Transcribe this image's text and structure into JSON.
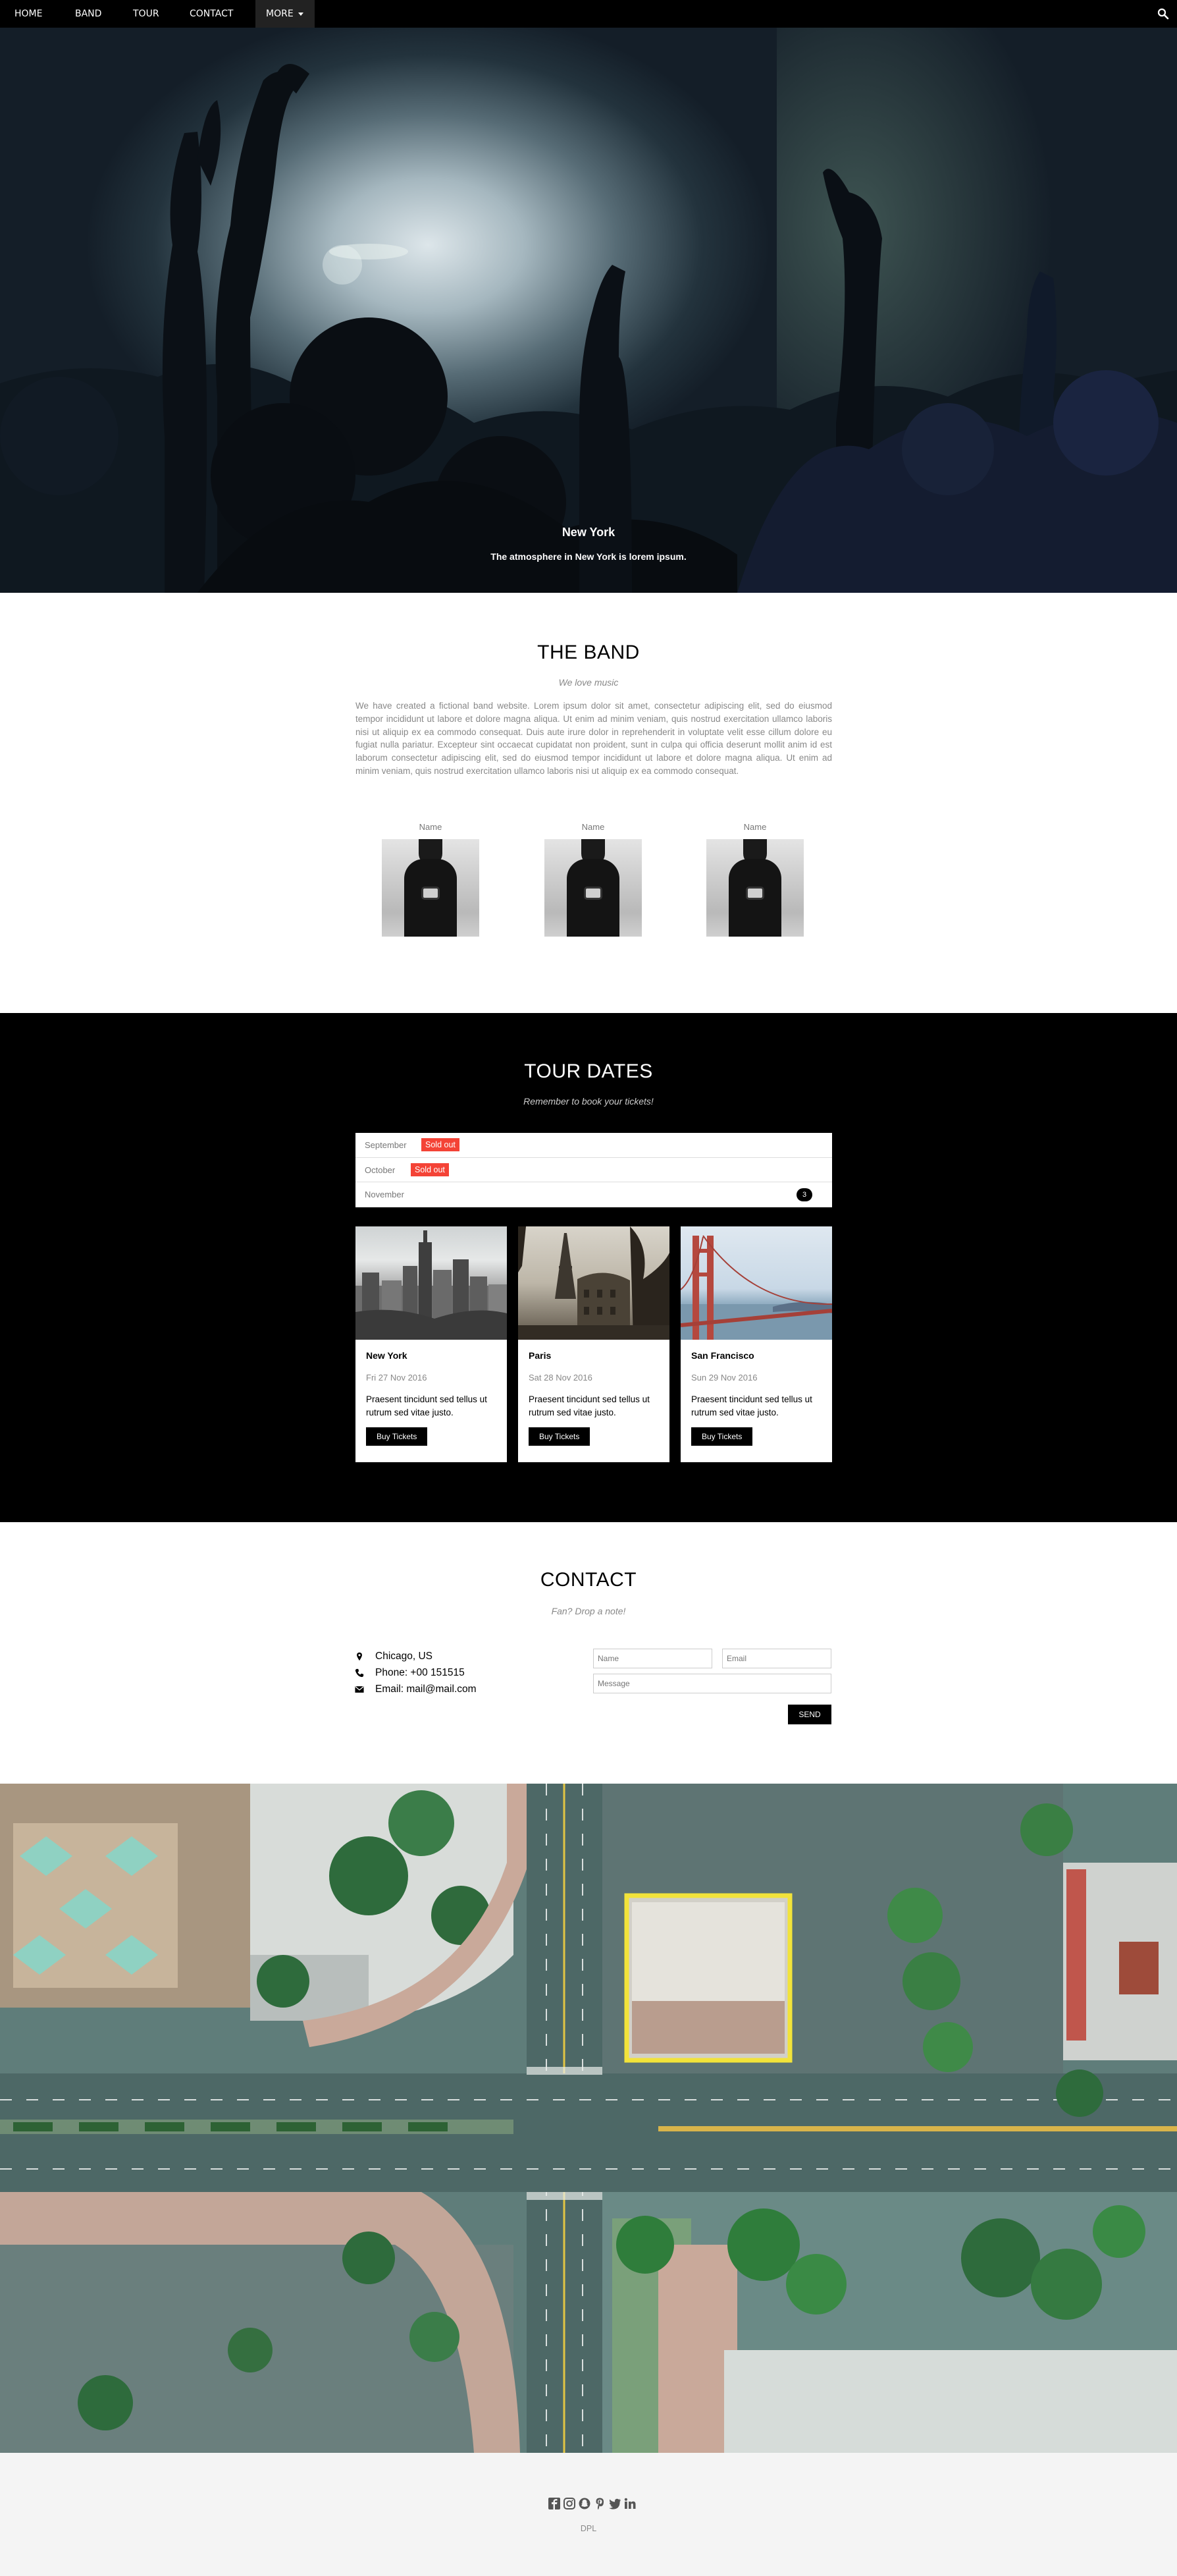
{
  "nav": {
    "items": [
      "HOME",
      "BAND",
      "TOUR",
      "CONTACT"
    ],
    "more_label": "MORE"
  },
  "hero": {
    "title": "New York",
    "subtitle": "The atmosphere in New York is lorem ipsum."
  },
  "band": {
    "title": "THE BAND",
    "subtitle": "We love music",
    "paragraph": "We have created a fictional band website. Lorem ipsum dolor sit amet, consectetur adipiscing elit, sed do eiusmod tempor incididunt ut labore et dolore magna aliqua. Ut enim ad minim veniam, quis nostrud exercitation ullamco laboris nisi ut aliquip ex ea commodo consequat. Duis aute irure dolor in reprehenderit in voluptate velit esse cillum dolore eu fugiat nulla pariatur. Excepteur sint occaecat cupidatat non proident, sunt in culpa qui officia deserunt mollit anim id est laborum consectetur adipiscing elit, sed do eiusmod tempor incididunt ut labore et dolore magna aliqua. Ut enim ad minim veniam, quis nostrud exercitation ullamco laboris nisi ut aliquip ex ea commodo consequat.",
    "members": [
      {
        "name": "Name"
      },
      {
        "name": "Name"
      },
      {
        "name": "Name"
      }
    ]
  },
  "tour": {
    "title": "TOUR DATES",
    "subtitle": "Remember to book your tickets!",
    "months": [
      {
        "month": "September",
        "status": "Sold out"
      },
      {
        "month": "October",
        "status": "Sold out"
      },
      {
        "month": "November",
        "badge": "3"
      }
    ],
    "cards": [
      {
        "city": "New York",
        "date": "Fri 27 Nov 2016",
        "desc": "Praesent tincidunt sed tellus ut rutrum sed vitae justo.",
        "button": "Buy Tickets"
      },
      {
        "city": "Paris",
        "date": "Sat 28 Nov 2016",
        "desc": "Praesent tincidunt sed tellus ut rutrum sed vitae justo.",
        "button": "Buy Tickets"
      },
      {
        "city": "San Francisco",
        "date": "Sun 29 Nov 2016",
        "desc": "Praesent tincidunt sed tellus ut rutrum sed vitae justo.",
        "button": "Buy Tickets"
      }
    ]
  },
  "contact": {
    "title": "CONTACT",
    "subtitle": "Fan? Drop a note!",
    "location": "Chicago, US",
    "phone": "Phone: +00 151515",
    "email": "Email: mail@mail.com",
    "name_placeholder": "Name",
    "email_placeholder": "Email",
    "message_placeholder": "Message",
    "send_label": "SEND"
  },
  "footer": {
    "icons": [
      "facebook-icon",
      "instagram-icon",
      "snapchat-icon",
      "pinterest-icon",
      "twitter-icon",
      "linkedin-icon"
    ],
    "text": "DPL"
  }
}
